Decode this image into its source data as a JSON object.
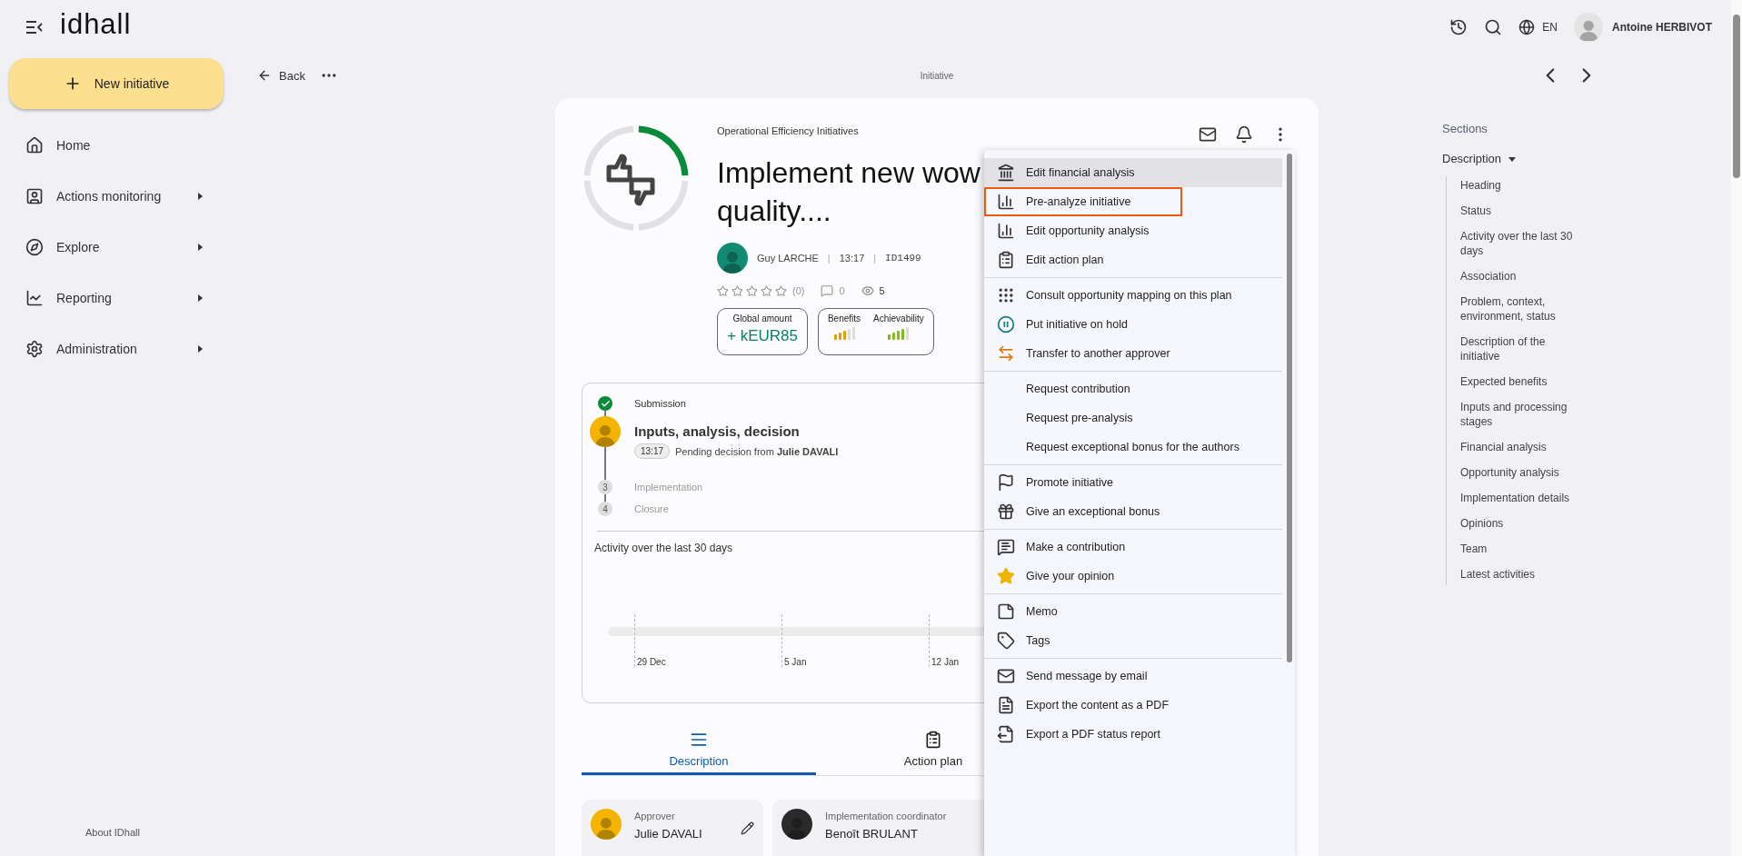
{
  "top_bar": {
    "logo": "idhall",
    "language": "EN",
    "user_name": "Antoine HERBIVOT"
  },
  "sidebar": {
    "new_button": "New initiative",
    "items": [
      {
        "label": "Home",
        "expandable": false
      },
      {
        "label": "Actions monitoring",
        "expandable": true
      },
      {
        "label": "Explore",
        "expandable": true
      },
      {
        "label": "Reporting",
        "expandable": true
      },
      {
        "label": "Administration",
        "expandable": true
      }
    ],
    "footer_link": "About IDhall"
  },
  "subheader": {
    "back": "Back",
    "page_title": "Initiative"
  },
  "initiative": {
    "category": "Operational Efficiency Initiatives",
    "title_lines": [
      "Implement new wow",
      "quality...."
    ],
    "author": "Guy LARCHE",
    "separator": "|",
    "time": "13:17",
    "id": "ID1499",
    "stars": 0,
    "rating_count": "(0)",
    "comments": "0",
    "views": "5",
    "amount": {
      "label": "Global amount",
      "value": "+ kEUR85"
    },
    "indicators": [
      {
        "label": "Benefits",
        "level": 0.6,
        "color": "#e0a100"
      },
      {
        "label": "Achievability",
        "level": 0.8,
        "color": "#86b91c"
      }
    ]
  },
  "status": {
    "steps": [
      {
        "kind": "done",
        "label": "Submission"
      },
      {
        "kind": "current",
        "label": "Inputs, analysis, decision",
        "time": "13:17",
        "note": "Pending decision from **Julie DAVALI**"
      },
      {
        "kind": "pending",
        "number": "3",
        "label": "Implementation"
      },
      {
        "kind": "pending",
        "number": "4",
        "label": "Closure"
      }
    ],
    "activity": {
      "title": "Activity over the last 30 days",
      "x_labels": [
        "29 Dec",
        "5 Jan",
        "12 Jan"
      ]
    }
  },
  "tabs": [
    {
      "label": "Description",
      "selected": true
    },
    {
      "label": "Action plan",
      "selected": false
    }
  ],
  "people": [
    {
      "role": "Approver",
      "name": "Julie DAVALI",
      "editable": true
    },
    {
      "role": "Implementation coordinator",
      "name": "Benoît BRULANT",
      "editable": false
    }
  ],
  "menu": {
    "groups": [
      [
        {
          "label": "Edit financial analysis",
          "hovered": true,
          "outlined": false
        },
        {
          "label": "Pre-analyze initiative",
          "hovered": false,
          "outlined": true
        },
        {
          "label": "Edit opportunity analysis",
          "hovered": false,
          "outlined": false
        },
        {
          "label": "Edit action plan",
          "hovered": false,
          "outlined": false
        }
      ],
      [
        {
          "label": "Consult opportunity mapping on this plan",
          "hovered": false,
          "outlined": false
        },
        {
          "label": "Put initiative on hold",
          "hovered": false,
          "outlined": false
        },
        {
          "label": "Transfer to another approver",
          "hovered": false,
          "outlined": false
        }
      ],
      [
        {
          "label": "Request contribution",
          "hovered": false,
          "outlined": false
        },
        {
          "label": "Request pre-analysis",
          "hovered": false,
          "outlined": false
        },
        {
          "label": "Request exceptional bonus for the authors",
          "hovered": false,
          "outlined": false
        }
      ],
      [
        {
          "label": "Promote initiative",
          "hovered": false,
          "outlined": false
        },
        {
          "label": "Give an exceptional bonus",
          "hovered": false,
          "outlined": false
        }
      ],
      [
        {
          "label": "Make a contribution",
          "hovered": false,
          "outlined": false
        },
        {
          "label": "Give your opinion",
          "hovered": false,
          "outlined": false
        }
      ],
      [
        {
          "label": "Memo",
          "hovered": false,
          "outlined": false
        },
        {
          "label": "Tags",
          "hovered": false,
          "outlined": false
        }
      ],
      [
        {
          "label": "Send message by email",
          "hovered": false,
          "outlined": false
        },
        {
          "label": "Export the content as a PDF",
          "hovered": false,
          "outlined": false
        },
        {
          "label": "Export a PDF status report",
          "hovered": false,
          "outlined": false
        }
      ]
    ]
  },
  "sections": {
    "title": "Sections",
    "current": "Description",
    "items": [
      "Heading",
      "Status",
      "Activity over the last 30 days",
      "Association",
      "Problem, context, environment, status",
      "Description of the initiative",
      "Expected benefits",
      "Inputs and processing stages",
      "Financial analysis",
      "Opportunity analysis",
      "Implementation details",
      "Opinions",
      "Team",
      "Latest activities"
    ]
  }
}
